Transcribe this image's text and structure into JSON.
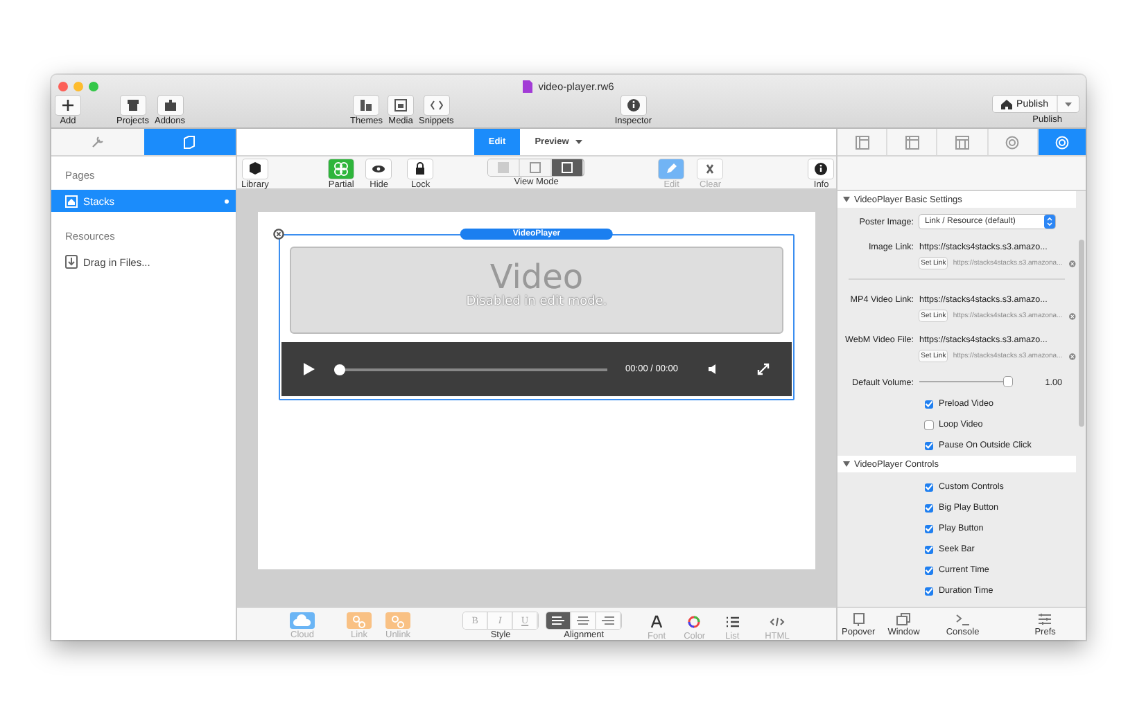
{
  "window": {
    "title": "video-player.rw6"
  },
  "toolbar": {
    "items": [
      {
        "label": "Add"
      },
      {
        "label": "Projects"
      },
      {
        "label": "Addons"
      },
      {
        "label": "Themes"
      },
      {
        "label": "Media"
      },
      {
        "label": "Snippets"
      },
      {
        "label": "Inspector"
      }
    ],
    "publish": {
      "button": "Publish",
      "label": "Publish"
    }
  },
  "sidebar": {
    "tabs": [
      {
        "selected": false
      },
      {
        "selected": true
      }
    ],
    "sections": [
      {
        "title": "Pages",
        "items": [
          {
            "label": "Stacks",
            "selected": true,
            "modified": true
          }
        ]
      },
      {
        "title": "Resources",
        "items": [
          {
            "label": "Drag in Files...",
            "selected": false,
            "modified": false
          }
        ]
      }
    ]
  },
  "mode_tabs": [
    {
      "label": "Edit",
      "selected": true,
      "dropdown": false
    },
    {
      "label": "Preview",
      "selected": false,
      "dropdown": true
    }
  ],
  "edit_toolbar": {
    "items": [
      {
        "label": "Library",
        "on": false
      },
      {
        "label": "Partial",
        "on": true
      },
      {
        "label": "Hide",
        "on": false
      },
      {
        "label": "Lock",
        "on": false
      }
    ],
    "view_mode": {
      "label": "View Mode",
      "options": [
        {
          "selected": false
        },
        {
          "selected": false
        },
        {
          "selected": true
        }
      ]
    },
    "tools": [
      {
        "label": "Edit",
        "on": true,
        "disabled": true
      },
      {
        "label": "Clear",
        "on": false,
        "disabled": true
      },
      {
        "label": "Info",
        "on": false,
        "disabled": false
      }
    ]
  },
  "canvas": {
    "stack_label": "VideoPlayer",
    "placeholder": {
      "title": "Video",
      "subtitle": "Disabled in edit mode."
    },
    "player": {
      "time": "00:00 / 00:00",
      "level": 0
    }
  },
  "inspector": {
    "tabs": [
      {
        "selected": false
      },
      {
        "selected": false
      },
      {
        "selected": false
      },
      {
        "selected": false
      },
      {
        "selected": true
      }
    ],
    "sections": [
      {
        "title": "VideoPlayer Basic Settings",
        "expanded": true,
        "rows": [
          {
            "kind": "select",
            "label": "Poster Image:",
            "value": "Link / Resource (default)"
          },
          {
            "kind": "link",
            "label": "Image Link:",
            "value": "https://stacks4stacks.s3.amazo...",
            "button": "Set Link",
            "path": "https://stacks4stacks.s3.amazona..."
          },
          {
            "kind": "divider"
          },
          {
            "kind": "link",
            "label": "MP4 Video Link:",
            "value": "https://stacks4stacks.s3.amazo...",
            "button": "Set Link",
            "path": "https://stacks4stacks.s3.amazona..."
          },
          {
            "kind": "link",
            "label": "WebM Video File:",
            "value": "https://stacks4stacks.s3.amazo...",
            "button": "Set Link",
            "path": "https://stacks4stacks.s3.amazona..."
          },
          {
            "kind": "slider",
            "label": "Default Volume:",
            "level": 0.97,
            "value": "1.00"
          },
          {
            "kind": "checkbox",
            "label": "Preload Video",
            "checked": true
          },
          {
            "kind": "checkbox",
            "label": "Loop Video",
            "checked": false
          },
          {
            "kind": "checkbox",
            "label": "Pause On Outside Click",
            "checked": true
          }
        ]
      },
      {
        "title": "VideoPlayer Controls",
        "expanded": true,
        "rows": [
          {
            "kind": "checkbox",
            "label": "Custom Controls",
            "checked": true
          },
          {
            "kind": "checkbox",
            "label": "Big Play Button",
            "checked": true
          },
          {
            "kind": "checkbox",
            "label": "Play Button",
            "checked": true
          },
          {
            "kind": "checkbox",
            "label": "Seek Bar",
            "checked": true
          },
          {
            "kind": "checkbox",
            "label": "Current Time",
            "checked": true
          },
          {
            "kind": "checkbox",
            "label": "Duration Time",
            "checked": true
          }
        ]
      }
    ]
  },
  "format_bar": {
    "tools_left": [
      {
        "label": "Cloud",
        "color": "#6bb5f5"
      },
      {
        "label": "Link",
        "color": "#f9c184"
      },
      {
        "label": "Unlink",
        "color": "#f9c184"
      }
    ],
    "style": {
      "label": "Style",
      "buttons": [
        "B",
        "I",
        "U"
      ]
    },
    "alignment": {
      "label": "Alignment",
      "options": [
        {
          "selected": true
        },
        {
          "selected": false
        },
        {
          "selected": false
        }
      ]
    },
    "tools_right": [
      {
        "label": "Font"
      },
      {
        "label": "Color"
      },
      {
        "label": "List"
      },
      {
        "label": "HTML"
      }
    ]
  },
  "inspector_bar": [
    {
      "label": "Popover"
    },
    {
      "label": "Window"
    },
    {
      "label": "Console"
    },
    {
      "label": "Prefs"
    }
  ]
}
